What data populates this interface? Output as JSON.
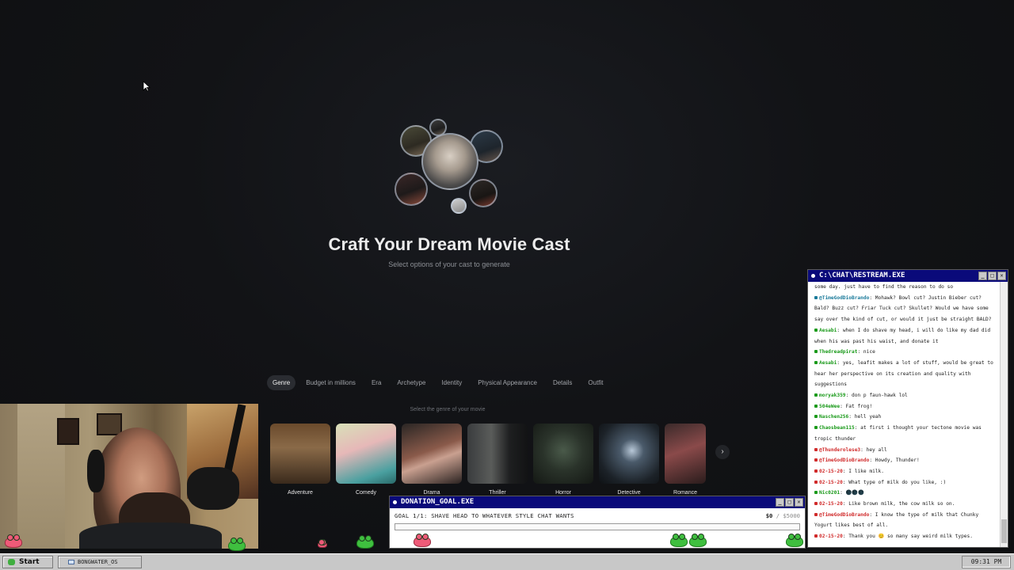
{
  "hero": {
    "title": "Craft Your Dream Movie Cast",
    "subtitle": "Select options of your cast to generate"
  },
  "tabs": [
    {
      "label": "Genre",
      "active": true
    },
    {
      "label": "Budget in millions"
    },
    {
      "label": "Era"
    },
    {
      "label": "Archetype"
    },
    {
      "label": "Identity"
    },
    {
      "label": "Physical Appearance"
    },
    {
      "label": "Details"
    },
    {
      "label": "Outfit"
    }
  ],
  "genre_hint": "Select the genre of your movie",
  "genres": [
    {
      "label": "Adventure"
    },
    {
      "label": "Comedy"
    },
    {
      "label": "Drama"
    },
    {
      "label": "Thriller"
    },
    {
      "label": "Horror"
    },
    {
      "label": "Detective"
    },
    {
      "label": "Romance"
    }
  ],
  "next_icon": "›",
  "chat": {
    "title": "C:\\CHAT\\RESTREAM.EXE",
    "messages": [
      {
        "user": "",
        "color": "#1a9a1a",
        "text": "some day. just have to find the reason to do so"
      },
      {
        "user": "@TimeGodDioBrando",
        "color": "#1a7a9a",
        "text": "Mohawk? Bowl cut? Justin Bieber cut? Bald? Buzz cut? Friar Tuck cut? Skullet? Would we have some say over the kind of cut, or would it just be straight BALD?"
      },
      {
        "user": "Aesabi",
        "color": "#1a9a1a",
        "text": "when I do shave my head, i will do like my dad did when his was past his waist, and donate it"
      },
      {
        "user": "Thedreadpirat",
        "color": "#1a9a1a",
        "text": "nice"
      },
      {
        "user": "Aesabi",
        "color": "#1a9a1a",
        "text": "yes, leafit makes a lot of stuff, would be great to hear her perspective on its creation and quality with suggestions"
      },
      {
        "user": "moryak359",
        "color": "#1a9a1a",
        "text": "don p faun-hawk lol"
      },
      {
        "user": "504eWee",
        "color": "#1a9a1a",
        "text": "Fat frog!"
      },
      {
        "user": "Naschen256",
        "color": "#1a9a1a",
        "text": "hell yeah"
      },
      {
        "user": "Chaosbean115",
        "color": "#1a9a1a",
        "text": "at first i thought your tectone movie was tropic thunder"
      },
      {
        "user": "@Thunderolese3",
        "color": "#d02a2a",
        "text": "hey all"
      },
      {
        "user": "@TimeGodDioBrando",
        "color": "#d02a2a",
        "text": "Howdy, Thunder!"
      },
      {
        "user": "02-15-20",
        "color": "#d02a2a",
        "text": "I like milk."
      },
      {
        "user": "02-15-20",
        "color": "#d02a2a",
        "text": "What type of milk do you like, :)"
      },
      {
        "user": "Nic0201",
        "color": "#1a9a1a",
        "text": "🌑🌑🌑"
      },
      {
        "user": "02-15-20",
        "color": "#d02a2a",
        "text": "Like brown milk, the cow milk so on."
      },
      {
        "user": "@TimeGodDioBrando",
        "color": "#d02a2a",
        "text": "I know the type of milk that Chunky Yogurt likes best of all."
      },
      {
        "user": "02-15-20",
        "color": "#d02a2a",
        "text": "Thank you 😊 so many say weird milk types."
      }
    ]
  },
  "donation": {
    "title": "DONATION_GOAL.EXE",
    "goal": "GOAL 1/1: SHAVE HEAD TO WHATEVER STYLE CHAT WANTS",
    "current": "$0",
    "separator": "/",
    "target": "$5000",
    "progress": 0
  },
  "taskbar": {
    "start_label": "Start",
    "item_label": "BONGWATER_OS",
    "clock": "09:31 PM"
  },
  "window_buttons": {
    "min": "_",
    "max": "□",
    "close": "✕"
  }
}
